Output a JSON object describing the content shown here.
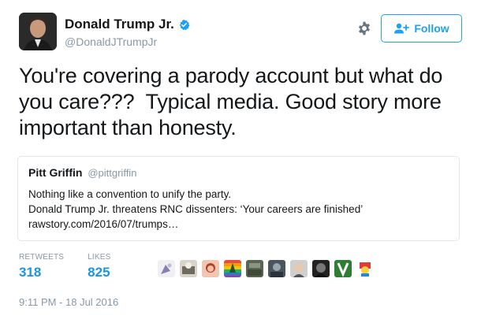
{
  "author": {
    "display_name": "Donald Trump Jr.",
    "handle": "@DonaldJTrumpJr",
    "verified": true
  },
  "actions": {
    "follow_label": "Follow",
    "settings_icon": "gear-icon",
    "follow_icon": "add-user-icon"
  },
  "tweet": {
    "text": "You're covering a parody account but what do you care???  Typical media. Good story more important than honesty."
  },
  "quoted_tweet": {
    "name": "Pitt Griffin",
    "handle": "@pittgriffin",
    "line1": "Nothing like a convention to unify the party.",
    "line2": "Donald Trump Jr. threatens RNC dissenters: ‘Your careers are finished’",
    "line3": "rawstory.com/2016/07/trumps…"
  },
  "stats": {
    "retweets_label": "RETWEETS",
    "retweets_value": "318",
    "likes_label": "LIKES",
    "likes_value": "825"
  },
  "likers": {
    "count_shown": 10
  },
  "timestamp": "9:11 PM - 18 Jul 2016",
  "colors": {
    "accent": "#1da1f2",
    "count_blue": "#1b95e0",
    "muted": "#8899a6",
    "border": "#e1e8ed"
  }
}
